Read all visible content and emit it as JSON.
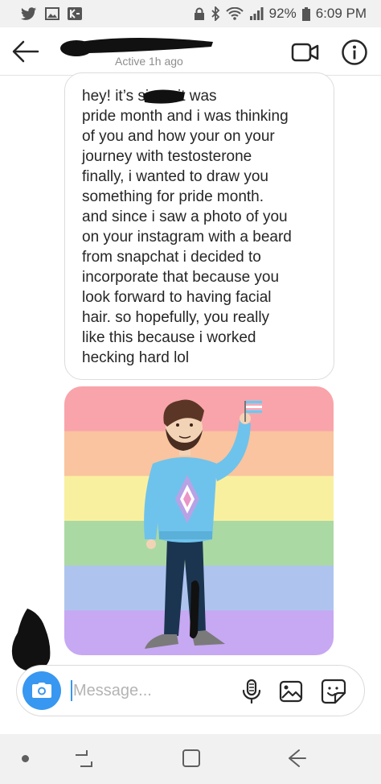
{
  "status_bar": {
    "battery": "92%",
    "time": "6:09 PM",
    "left_icons": [
      "twitter-icon",
      "gallery-icon",
      "kik-icon"
    ],
    "right_icons": [
      "lock-icon",
      "bluetooth-icon",
      "wifi-icon",
      "signal-icon",
      "battery-icon"
    ]
  },
  "header": {
    "status": "Active 1h ago",
    "icons": [
      "back-arrow-icon",
      "video-call-icon",
      "info-icon"
    ]
  },
  "message": {
    "text": "hey! it’s          since it was\npride month and i was thinking\nof you and how your on your\njourney with testosterone\nfinally, i wanted to draw you\nsomething for pride month.\nand since i saw a photo of you\non your instagram with a beard\nfrom snapchat i decided to\nincorporate that because you\nlook forward to having facial\nhair. so hopefully, you really\nlike this because i worked\nhecking hard lol"
  },
  "image_message": {
    "stripe_colors": [
      "#f9a4aa",
      "#f9c49f",
      "#f9f09f",
      "#abd9a4",
      "#aec4ee",
      "#c7a8f2"
    ],
    "flag_colors": [
      "#f5a9b8",
      "#ffffff",
      "#5bcefa"
    ]
  },
  "composer": {
    "placeholder": "Message...",
    "value": "",
    "accent": "#3897f0",
    "icons": [
      "camera-icon",
      "microphone-icon",
      "gallery-icon",
      "sticker-icon"
    ]
  },
  "nav_bar": {
    "icons": [
      "nav-dot-icon",
      "recent-apps-icon",
      "home-icon",
      "back-icon"
    ]
  }
}
